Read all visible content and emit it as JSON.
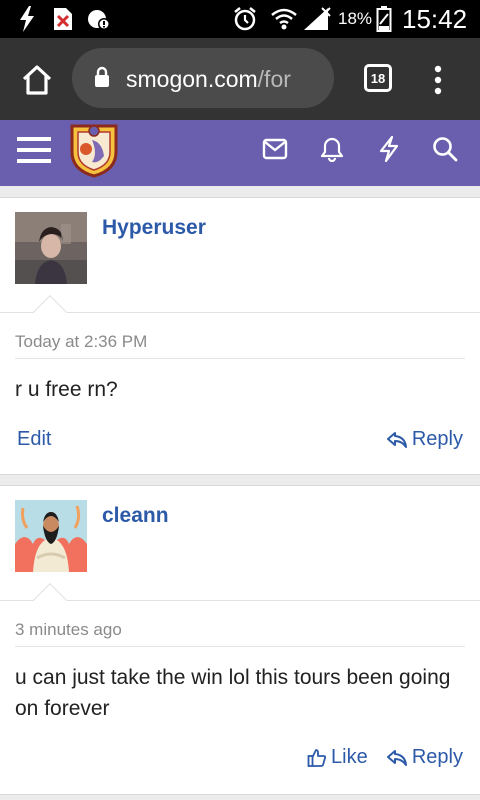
{
  "status_bar": {
    "battery": "18%",
    "time": "15:42",
    "icons": [
      "charging-bolt-icon",
      "notification-blocked-icon",
      "sync-icon",
      "alarm-icon",
      "wifi-icon",
      "signal-icon",
      "battery-icon"
    ]
  },
  "browser": {
    "url_domain": "smogon.com",
    "url_path": "/for",
    "tab_count": "18",
    "icons": [
      "home-icon",
      "lock-icon",
      "tab-switcher-icon",
      "menu-icon"
    ]
  },
  "site_nav": {
    "icons": [
      "hamburger-icon",
      "site-logo",
      "envelope-icon",
      "bell-icon",
      "bolt-icon",
      "search-icon"
    ]
  },
  "posts": [
    {
      "username": "Hyperuser",
      "timestamp": "Today at 2:36 PM",
      "message": "r u free rn?",
      "actions": {
        "left": "Edit",
        "right": "Reply"
      }
    },
    {
      "username": "cleann",
      "timestamp": "3 minutes ago",
      "message": "u can just take the win lol this tours been going on forever",
      "actions": {
        "like": "Like",
        "right": "Reply"
      }
    }
  ],
  "colors": {
    "nav_purple": "#6a5fae",
    "link_blue": "#2c5aa8",
    "chrome_dark": "#333333"
  }
}
